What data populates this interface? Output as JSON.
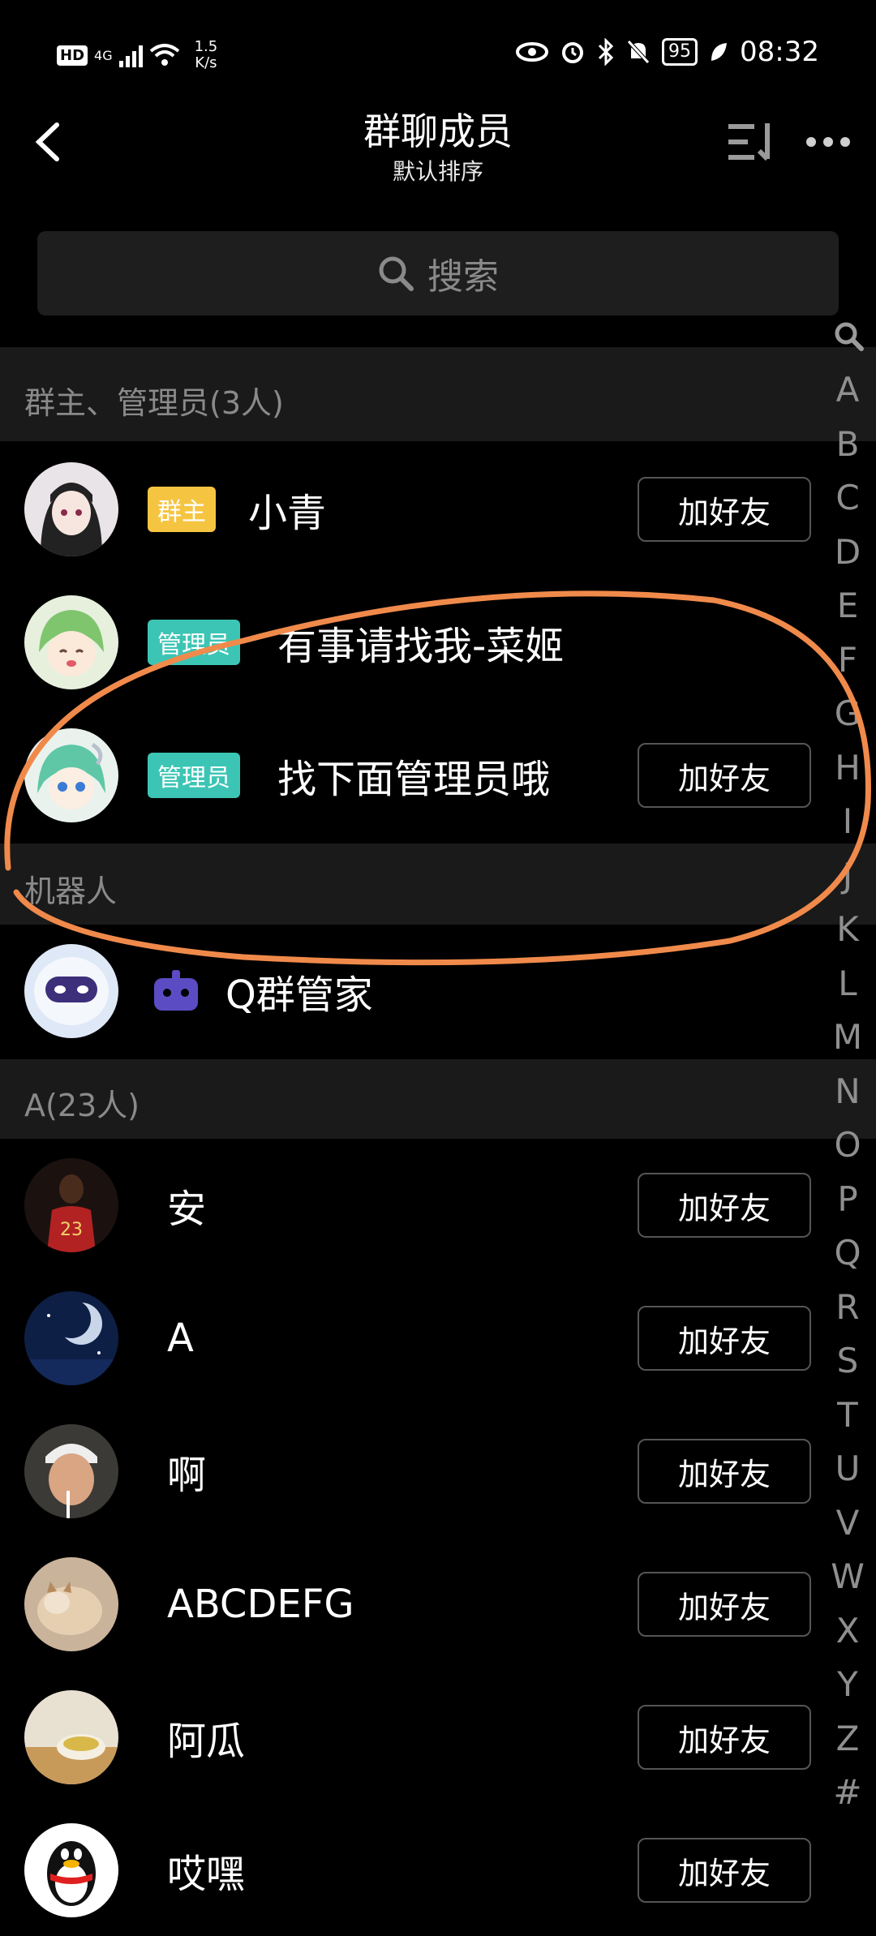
{
  "status_bar": {
    "hd": "HD",
    "network": "4G",
    "speed_value": "1.5",
    "speed_unit": "K/s",
    "battery": "95",
    "time": "08:32"
  },
  "header": {
    "title": "群聊成员",
    "subtitle": "默认排序"
  },
  "search": {
    "placeholder": "搜索"
  },
  "sections": {
    "admins": "群主、管理员(3人)",
    "bots": "机器人",
    "a_group": "A(23人)"
  },
  "members": {
    "owner": {
      "badge": "群主",
      "name": "小青",
      "add_label": "加好友"
    },
    "admin1": {
      "badge": "管理员",
      "name": "有事请找我-菜姬"
    },
    "admin2": {
      "badge": "管理员",
      "name": "找下面管理员哦",
      "add_label": "加好友"
    },
    "bot": {
      "name": "Q群管家"
    },
    "a_list": [
      {
        "name": "安",
        "add_label": "加好友"
      },
      {
        "name": "A",
        "add_label": "加好友"
      },
      {
        "name": "啊",
        "add_label": "加好友"
      },
      {
        "name": "ABCDEFG",
        "add_label": "加好友"
      },
      {
        "name": "阿瓜",
        "add_label": "加好友"
      },
      {
        "name": "哎嘿",
        "add_label": "加好友"
      }
    ]
  },
  "index_letters": [
    "A",
    "B",
    "C",
    "D",
    "E",
    "F",
    "G",
    "H",
    "I",
    "J",
    "K",
    "L",
    "M",
    "N",
    "O",
    "P",
    "Q",
    "R",
    "S",
    "T",
    "U",
    "V",
    "W",
    "X",
    "Y",
    "Z",
    "#"
  ],
  "colors": {
    "background": "#000000",
    "owner_badge": "#f5c542",
    "admin_badge": "#3cc5b4",
    "annotation": "#f08a4b"
  }
}
